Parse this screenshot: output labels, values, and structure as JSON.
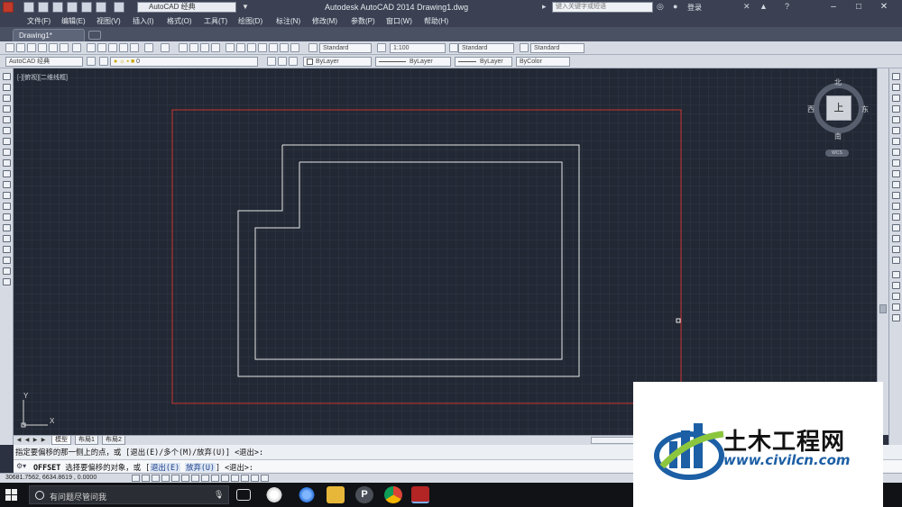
{
  "window": {
    "workspace": "AutoCAD 经典",
    "title": "Autodesk AutoCAD 2014    Drawing1.dwg",
    "search_placeholder": "键入关键字或短语",
    "login": "登录"
  },
  "menu": [
    "文件(F)",
    "编辑(E)",
    "视图(V)",
    "插入(I)",
    "格式(O)",
    "工具(T)",
    "绘图(D)",
    "标注(N)",
    "修改(M)",
    "参数(P)",
    "窗口(W)",
    "帮助(H)"
  ],
  "doc_tab": "Drawing1*",
  "toolbar": {
    "text_style": "Standard",
    "anno_scale": "1:100",
    "dim_style": "Standard",
    "table_style": "Standard",
    "workspace": "AutoCAD 经典",
    "layer": "0",
    "color": "ByLayer",
    "linetype": "ByLayer",
    "lineweight": "ByLayer",
    "plotstyle": "ByColor"
  },
  "viewport": {
    "label": "[-][俯视][二维线框]",
    "viewcube": {
      "north": "北",
      "south": "南",
      "east": "东",
      "west": "西",
      "face": "上",
      "wcs": "WCS"
    },
    "ucs": {
      "x": "X",
      "y": "Y"
    },
    "colors": {
      "background": "#222834",
      "rectangle": "#c8352e",
      "polyline": "#e8e8e8"
    }
  },
  "layout_tabs": [
    "模型",
    "布局1",
    "布局2"
  ],
  "command": {
    "history": "指定要偏移的那一侧上的点，或 [退出(E)/多个(M)/放弃(U)] <退出>:",
    "prompt_cmd": "OFFSET",
    "prompt_text": "选择要偏移的对象，或 [",
    "opt1": "退出(E)",
    "opt2": "放弃(U)",
    "prompt_end": "] <退出>:"
  },
  "status": {
    "coords": "30681.7562, 6634.8619 , 0.0000"
  },
  "taskbar": {
    "search": "有问题尽管问我"
  },
  "watermark": {
    "title": "土木工程网",
    "url": "www.civilcn.com"
  }
}
